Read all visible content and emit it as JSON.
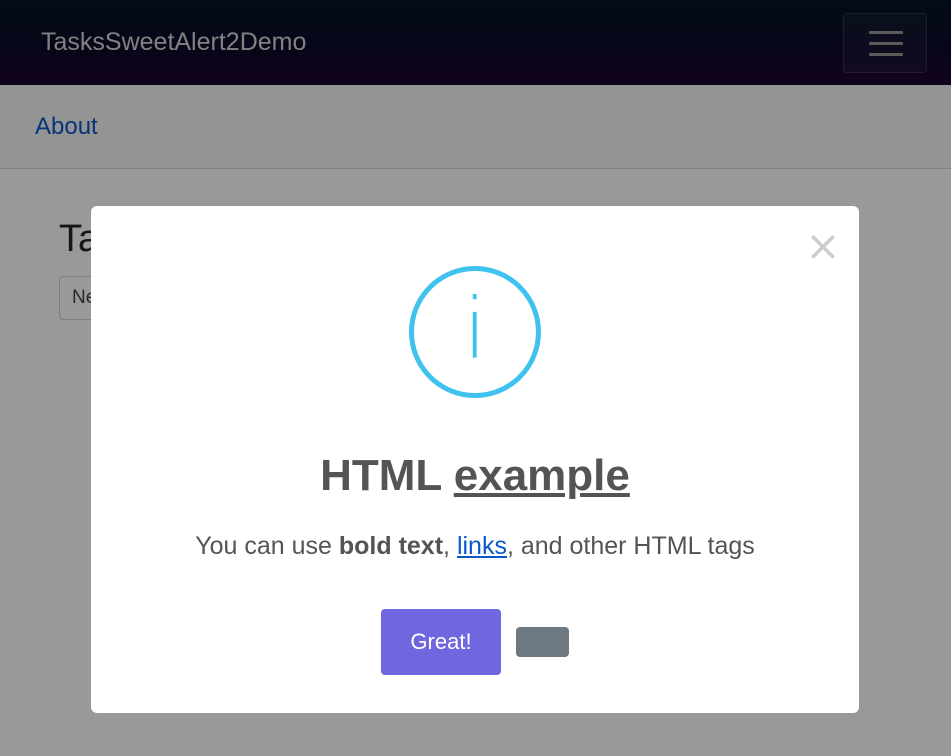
{
  "navbar": {
    "brand": "TasksSweetAlert2Demo",
    "toggler_icon": "hamburger-menu-icon"
  },
  "subnav": {
    "about_label": "About"
  },
  "page": {
    "title": "Ta",
    "input_value": "Ne"
  },
  "modal": {
    "close_glyph": "×",
    "icon_glyph": "i",
    "icon_name": "info-icon",
    "icon_color": "#3fc3ee",
    "title_plain": "HTML ",
    "title_underlined": "example",
    "text_part1": "You can use ",
    "text_bold": "bold text",
    "text_part2": ", ",
    "text_link": "links",
    "text_part3": ", and other HTML tags",
    "confirm_label": "Great!",
    "cancel_label": "",
    "confirm_color": "#7066e0",
    "cancel_color": "#6e7881"
  }
}
